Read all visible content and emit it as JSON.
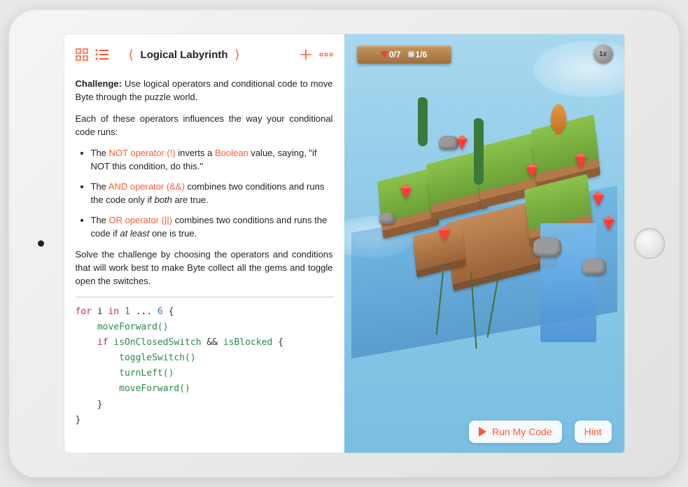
{
  "colors": {
    "accent": "#ff5a33"
  },
  "toolbar": {
    "title": "Logical Labyrinth"
  },
  "hud": {
    "gem_count": "0/7",
    "switch_count": "1/6",
    "speed": "1x"
  },
  "instructions": {
    "challenge_label": "Challenge:",
    "challenge_text": " Use logical operators and conditional code to move Byte through the puzzle world.",
    "intro_2": "Each of these operators influences the way your conditional code runs:",
    "bullets": [
      {
        "pre": "The ",
        "link": "NOT operator (!)",
        "mid": " inverts a ",
        "link2": "Boolean",
        "post": " value, saying, \"if NOT this condition, do this.\""
      },
      {
        "pre": "The ",
        "link": "AND operator (&&)",
        "mid": " combines two conditions and runs the code only if ",
        "em": "both",
        "post": " are true."
      },
      {
        "pre": "The ",
        "link": "OR operator (||)",
        "mid": " combines two conditions and runs the code if ",
        "em": "at least",
        "post": " one is true."
      }
    ],
    "solve": "Solve the challenge by choosing the operators and conditions that will work best to make Byte collect all the gems and toggle open the switches."
  },
  "code": {
    "kw_for": "for",
    "kw_in": "in",
    "kw_if": "if",
    "var_i": "i",
    "range_lo": "1",
    "range_dots": " ... ",
    "range_hi": "6",
    "fn_moveForward": "moveForward()",
    "cond_l": "isOnClosedSwitch",
    "op_and": "&&",
    "cond_r": "isBlocked",
    "fn_toggleSwitch": "toggleSwitch()",
    "fn_turnLeft": "turnLeft()"
  },
  "buttons": {
    "run": "Run My Code",
    "hint": "Hint"
  }
}
